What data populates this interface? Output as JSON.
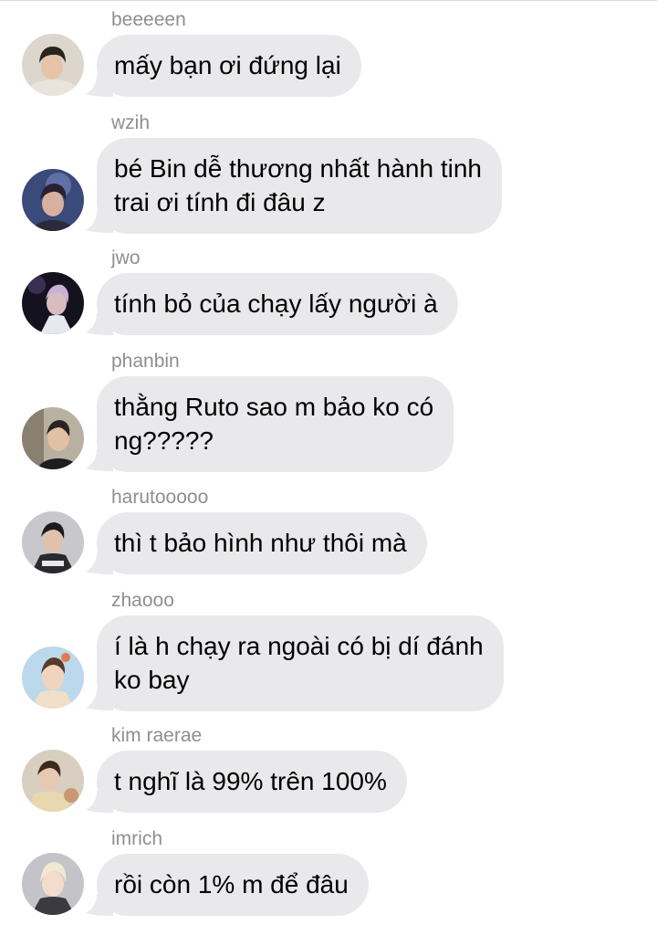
{
  "colors": {
    "bubble": "#e9e9eb",
    "sender_name": "#8e8e93",
    "text": "#000000",
    "background": "#ffffff"
  },
  "messages": [
    {
      "sender": "beeeeen",
      "text": "mấy bạn ơi đứng lại",
      "avatar_icon": "profile-photo"
    },
    {
      "sender": "wzih",
      "text": "bé Bin dễ thương nhất hành tinh\ntrai ơi tính đi đâu z",
      "avatar_icon": "profile-photo"
    },
    {
      "sender": "jwo",
      "text": "tính bỏ của chạy lấy người à",
      "avatar_icon": "profile-photo"
    },
    {
      "sender": "phanbin",
      "text": "thằng Ruto sao m bảo ko có\nng?????",
      "avatar_icon": "profile-photo"
    },
    {
      "sender": "harutooooo",
      "text": "thì t bảo hình như thôi mà",
      "avatar_icon": "profile-photo"
    },
    {
      "sender": "zhaooo",
      "text": "í là h chạy ra ngoài có bị dí đánh\nko bay",
      "avatar_icon": "profile-photo"
    },
    {
      "sender": "kim raerae",
      "text": "t nghĩ là 99% trên 100%",
      "avatar_icon": "profile-photo"
    },
    {
      "sender": "imrich",
      "text": "rồi còn 1% m để đâu",
      "avatar_icon": "profile-photo"
    }
  ]
}
